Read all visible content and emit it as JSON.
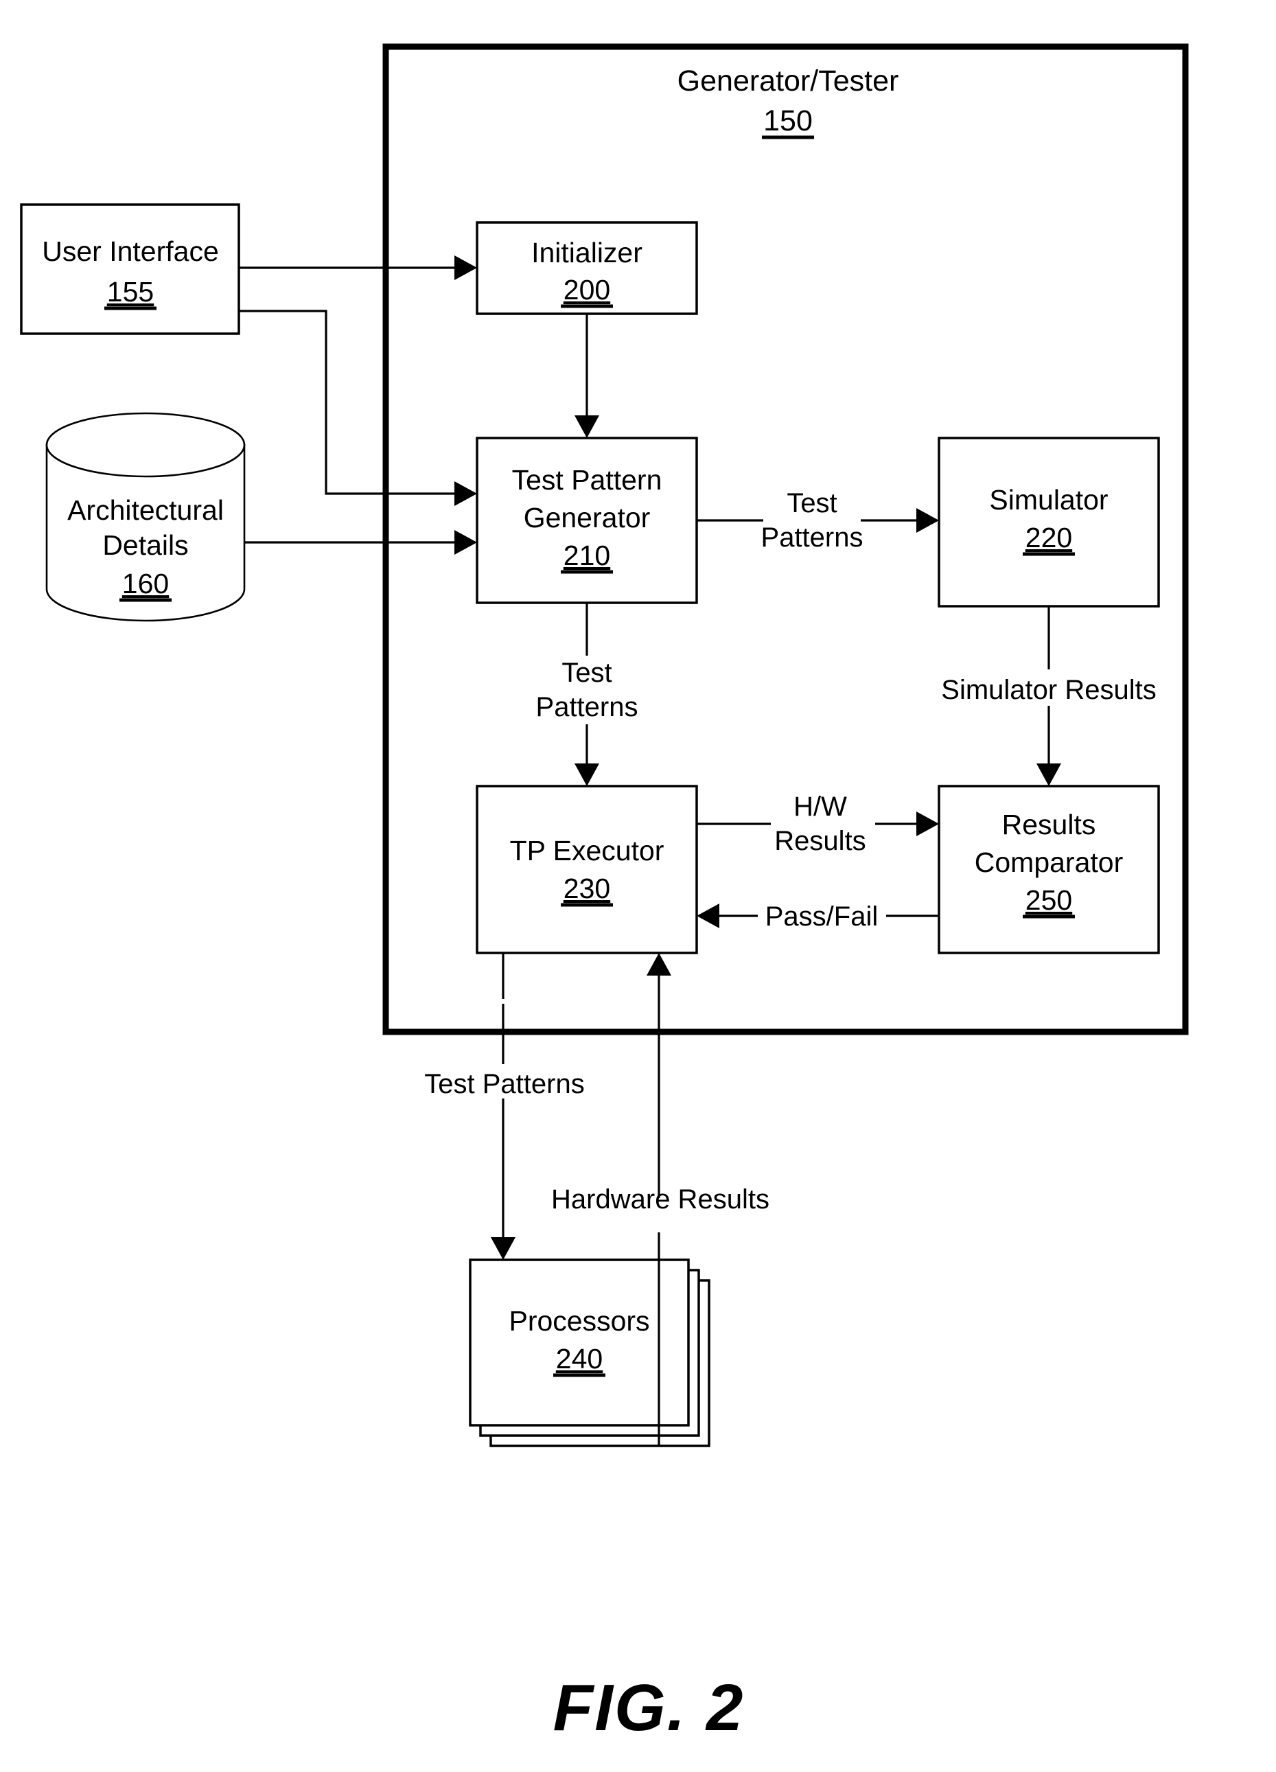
{
  "figure": {
    "caption": "FIG. 2"
  },
  "outer_container": {
    "title": "Generator/Tester",
    "ref": "150"
  },
  "blocks": [
    {
      "id": "user-interface",
      "label_line1": "User Interface",
      "label_line2": "",
      "ref": "155",
      "shape": "rect"
    },
    {
      "id": "architectural-details",
      "label_line1": "Architectural",
      "label_line2": "Details",
      "ref": "160",
      "shape": "cylinder"
    },
    {
      "id": "initializer",
      "label_line1": "Initializer",
      "label_line2": "",
      "ref": "200",
      "shape": "rect"
    },
    {
      "id": "test-pattern-generator",
      "label_line1": "Test Pattern",
      "label_line2": "Generator",
      "ref": "210",
      "shape": "rect"
    },
    {
      "id": "simulator",
      "label_line1": "Simulator",
      "label_line2": "",
      "ref": "220",
      "shape": "rect"
    },
    {
      "id": "tp-executor",
      "label_line1": "TP Executor",
      "label_line2": "",
      "ref": "230",
      "shape": "rect"
    },
    {
      "id": "processors",
      "label_line1": "Processors",
      "label_line2": "",
      "ref": "240",
      "shape": "stacked-rect"
    },
    {
      "id": "results-comparator",
      "label_line1": "Results",
      "label_line2": "Comparator",
      "ref": "250",
      "shape": "rect"
    }
  ],
  "edge_labels": {
    "tpg_to_simulator_line1": "Test",
    "tpg_to_simulator_line2": "Patterns",
    "tpg_to_executor_line1": "Test",
    "tpg_to_executor_line2": "Patterns",
    "simulator_to_comparator": "Simulator Results",
    "executor_to_comparator_line1": "H/W",
    "executor_to_comparator_line2": "Results",
    "comparator_to_executor": "Pass/Fail",
    "executor_to_processors": "Test Patterns",
    "processors_to_executor": "Hardware Results"
  }
}
